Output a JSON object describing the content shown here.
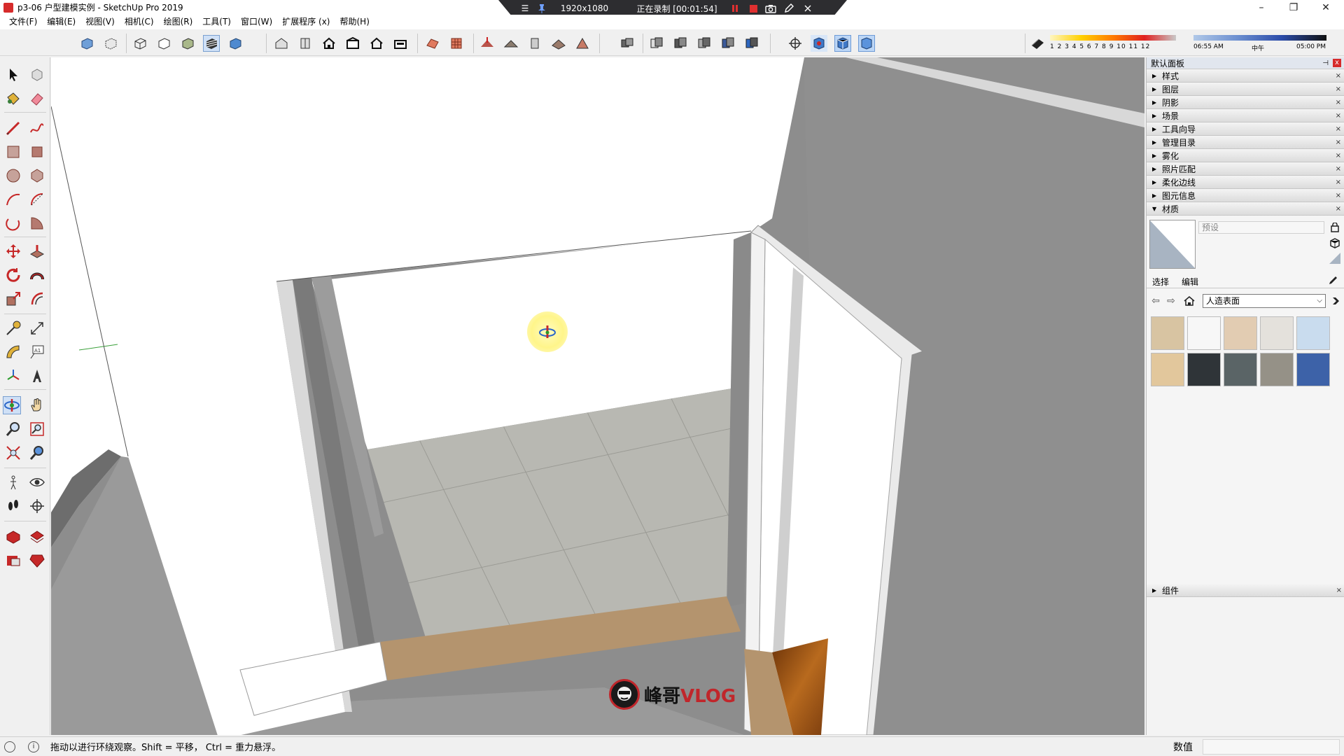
{
  "window": {
    "title": "p3-06 户型建模实例 - SketchUp Pro 2019",
    "minimize": "–",
    "maximize": "❐",
    "close": "✕"
  },
  "recorder": {
    "menu_glyph": "☰",
    "resolution": "1920x1080",
    "status": "正在录制 [00:01:54]"
  },
  "menu": [
    {
      "label": "文件(F)"
    },
    {
      "label": "编辑(E)"
    },
    {
      "label": "视图(V)"
    },
    {
      "label": "相机(C)"
    },
    {
      "label": "绘图(R)"
    },
    {
      "label": "工具(T)"
    },
    {
      "label": "窗口(W)"
    },
    {
      "label": "扩展程序 (x)"
    },
    {
      "label": "帮助(H)"
    }
  ],
  "shadow": {
    "months": "1  2  3  4  5  6  7  8  9  10 11 12",
    "time_start": "06:55 AM",
    "time_mid": "中午",
    "time_end": "05:00 PM"
  },
  "tray": {
    "title": "默认面板",
    "pin": "⊣",
    "close": "x",
    "panels": [
      {
        "label": "样式",
        "expanded": false
      },
      {
        "label": "图层",
        "expanded": false
      },
      {
        "label": "阴影",
        "expanded": false
      },
      {
        "label": "场景",
        "expanded": false
      },
      {
        "label": "工具向导",
        "expanded": false
      },
      {
        "label": "管理目录",
        "expanded": false
      },
      {
        "label": "雾化",
        "expanded": false
      },
      {
        "label": "照片匹配",
        "expanded": false
      },
      {
        "label": "柔化边线",
        "expanded": false
      },
      {
        "label": "图元信息",
        "expanded": false
      },
      {
        "label": "材质",
        "expanded": true
      }
    ],
    "arrow_collapsed": "▶",
    "arrow_expanded": "▼",
    "row_close": "×",
    "materials": {
      "name_placeholder": "预设",
      "tab_select": "选择",
      "tab_edit": "编辑",
      "nav_back": "⇦",
      "nav_forward": "⇨",
      "library": "人造表面",
      "caret": "⌵",
      "swatches": [
        "#d8c4a2",
        "#f7f7f7",
        "#e2ccb2",
        "#e4e1dc",
        "#c9dcee",
        "#e2c79c",
        "#2f3438",
        "#5a6466",
        "#959187",
        "#3d62a8"
      ]
    },
    "components_label": "组件"
  },
  "status": {
    "info_glyph": "i",
    "hint": "拖动以进行环绕观察。Shift = 平移， Ctrl = 重力悬浮。",
    "measurement_label": "数值"
  },
  "watermark": {
    "text_cn": "峰哥",
    "text_en": "VLOG"
  }
}
